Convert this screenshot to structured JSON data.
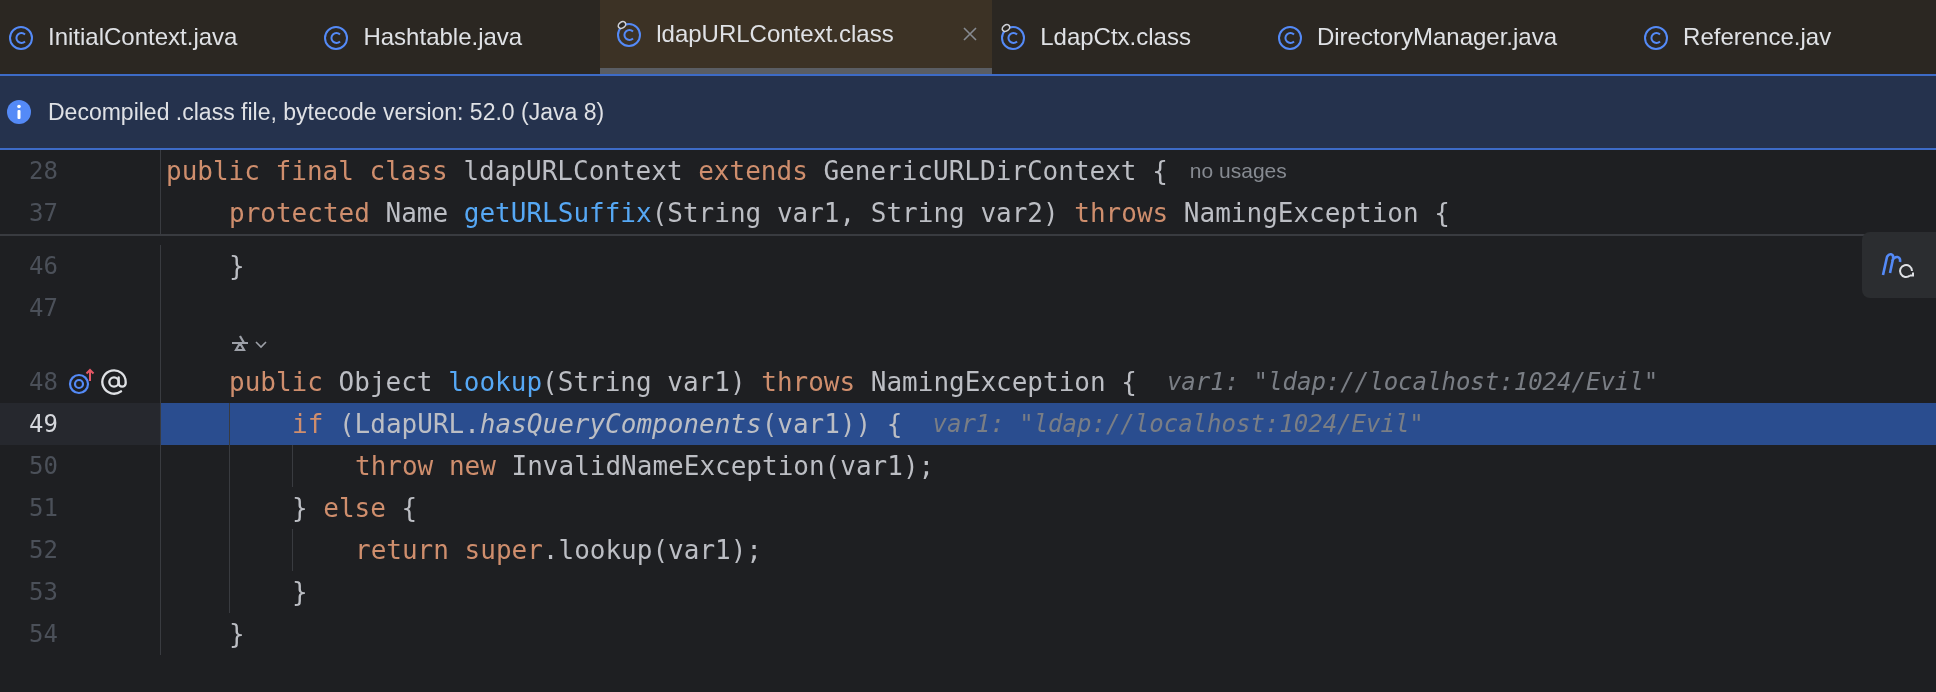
{
  "tabs": [
    {
      "label": "InitialContext.java",
      "kind": "java",
      "selected": false
    },
    {
      "label": "Hashtable.java",
      "kind": "java",
      "selected": false
    },
    {
      "label": "ldapURLContext.class",
      "kind": "class",
      "selected": true
    },
    {
      "label": "LdapCtx.class",
      "kind": "class",
      "selected": false
    },
    {
      "label": "DirectoryManager.java",
      "kind": "java",
      "selected": false
    },
    {
      "label": "Reference.jav",
      "kind": "java",
      "selected": false
    }
  ],
  "banner": {
    "text": "Decompiled .class file, bytecode version: 52.0 (Java 8)"
  },
  "sticky_lines": [
    {
      "number": "28",
      "tokens": [
        {
          "kind": "keyword",
          "text": "public final class"
        },
        {
          "kind": "plain",
          "text": " ldapURLContext "
        },
        {
          "kind": "keyword",
          "text": "extends"
        },
        {
          "kind": "plain",
          "text": " GenericURLDirContext {"
        }
      ],
      "hint": {
        "kind": "usage",
        "text": "no usages"
      }
    },
    {
      "number": "37",
      "tokens": [
        {
          "kind": "keyword",
          "text": "    protected"
        },
        {
          "kind": "plain",
          "text": " Name "
        },
        {
          "kind": "method",
          "text": "getURLSuffix"
        },
        {
          "kind": "plain",
          "text": "(String var1, String var2) "
        },
        {
          "kind": "keyword",
          "text": "throws"
        },
        {
          "kind": "plain",
          "text": " NamingException {"
        }
      ]
    }
  ],
  "lines": [
    {
      "kind": "code",
      "number": "46",
      "selected": false,
      "code_vision": false,
      "tokens": [
        {
          "kind": "plain",
          "text": "    }"
        }
      ]
    },
    {
      "kind": "code",
      "number": "47",
      "selected": false,
      "code_vision": false
    },
    {
      "kind": "override",
      "number": "48",
      "selected": false,
      "code_vision": true,
      "tokens": [
        {
          "kind": "keyword",
          "text": "    public"
        },
        {
          "kind": "plain",
          "text": " Object "
        },
        {
          "kind": "method",
          "text": "lookup"
        },
        {
          "kind": "plain",
          "text": "(String var1) "
        },
        {
          "kind": "keyword",
          "text": "throws"
        },
        {
          "kind": "plain",
          "text": " NamingException {"
        }
      ],
      "hint": {
        "kind": "inlay",
        "text": "var1: \"ldap://localhost:1024/Evil\""
      }
    },
    {
      "kind": "code",
      "number": "49",
      "selected": true,
      "code_vision": false,
      "tokens": [
        {
          "kind": "keyword",
          "text": "        if"
        },
        {
          "kind": "plain",
          "text": " (LdapURL."
        },
        {
          "kind": "static_call",
          "text": "hasQueryComponents"
        },
        {
          "kind": "plain",
          "text": "(var1)) {"
        }
      ],
      "hint": {
        "kind": "inlay",
        "text": "var1: \"ldap://localhost:1024/Evil\""
      }
    },
    {
      "kind": "code",
      "number": "50",
      "selected": false,
      "code_vision": false,
      "tokens": [
        {
          "kind": "keyword",
          "text": "            throw new"
        },
        {
          "kind": "plain",
          "text": " InvalidNameException(var1);"
        }
      ]
    },
    {
      "kind": "code",
      "number": "51",
      "selected": false,
      "code_vision": false,
      "tokens": [
        {
          "kind": "plain",
          "text": "        } "
        },
        {
          "kind": "keyword",
          "text": "else"
        },
        {
          "kind": "plain",
          "text": " {"
        }
      ]
    },
    {
      "kind": "code",
      "number": "52",
      "selected": false,
      "code_vision": false,
      "tokens": [
        {
          "kind": "keyword",
          "text": "            return super"
        },
        {
          "kind": "plain",
          "text": ".lookup(var1);"
        }
      ]
    },
    {
      "kind": "code",
      "number": "53",
      "selected": false,
      "code_vision": false,
      "tokens": [
        {
          "kind": "plain",
          "text": "        }"
        }
      ]
    },
    {
      "kind": "code",
      "number": "54",
      "selected": false,
      "code_vision": false,
      "tokens": [
        {
          "kind": "plain",
          "text": "    }"
        }
      ]
    }
  ]
}
